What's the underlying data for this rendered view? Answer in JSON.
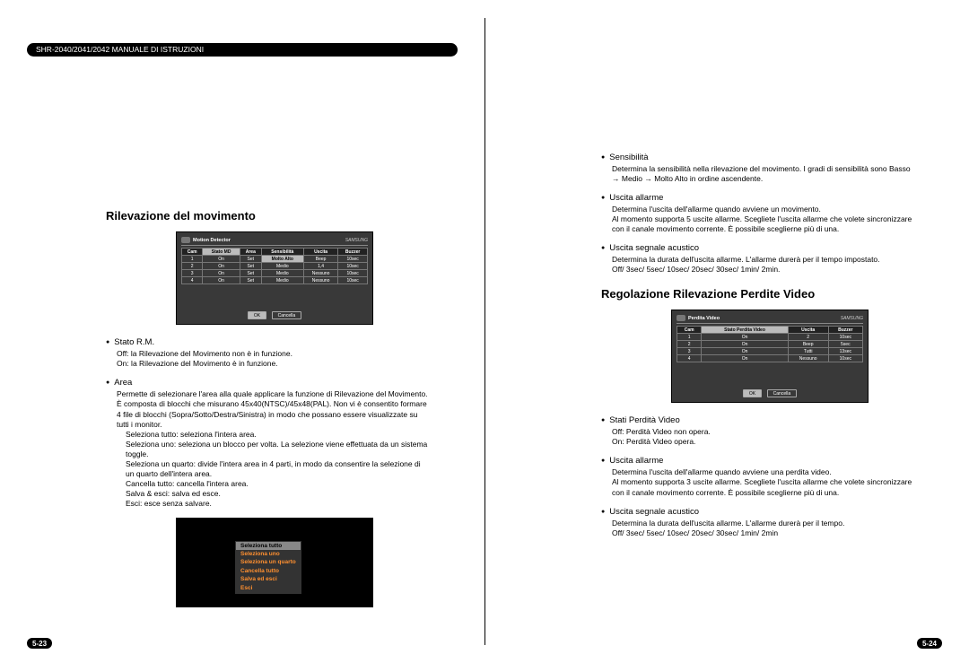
{
  "banner": "SHR-2040/2041/2042 MANUALE DI ISTRUZIONI",
  "page_left": "5-23",
  "page_right": "5-24",
  "section_left_title": "Rilevazione del movimento",
  "scr1": {
    "title": "Motion Detector",
    "logo": "SAMSUNG",
    "headers": [
      "Cam",
      "Stato MD",
      "Area",
      "Sensibilità",
      "Uscita",
      "Buzzer"
    ],
    "rows": [
      [
        "1",
        "On",
        "Set",
        "Molto Alto",
        "Beep",
        "10sec"
      ],
      [
        "2",
        "On",
        "Set",
        "Medio",
        "1,4",
        "10sec"
      ],
      [
        "3",
        "On",
        "Set",
        "Medio",
        "Nessuno",
        "10sec"
      ],
      [
        "4",
        "On",
        "Set",
        "Medio",
        "Nessuno",
        "10sec"
      ]
    ],
    "btn_ok": "OK",
    "btn_cancel": "Cancella"
  },
  "left_items": [
    {
      "label": "Stato R.M.",
      "desc": "Off: la Rilevazione del Movimento non è in funzione.\nOn: la Rilevazione del Movimento è in funzione."
    },
    {
      "label": "Area",
      "desc": "Permette di selezionare l'area alla quale applicare la funzione di Rilevazione del Movimento. È composta di blocchi che misurano 45x40(NTSC)/45x48(PAL). Non vi è consentito formare 4 file di blocchi (Sopra/Sotto/Destra/Sinistra) in modo che possano essere visualizzate su tutti i monitor.",
      "sublines": [
        "Seleziona tutto: seleziona l'intera area.",
        "Seleziona uno: seleziona un blocco per volta. La selezione viene effettuata da un sistema toggle.",
        "Seleziona un quarto: divide l'intera area in 4 parti, in modo da consentire la selezione di un quarto dell'intera area.",
        "Cancella tutto: cancella l'intera area.",
        "Salva & esci: salva ed esce.",
        "Esci: esce senza salvare."
      ]
    }
  ],
  "scr3_items": [
    "Seleziona tutto",
    "Seleziona uno",
    "Seleziona un quarto",
    "Cancella tutto",
    "Salva ed esci",
    "Esci"
  ],
  "right_items_top": [
    {
      "label": "Sensibilità",
      "desc": "Determina la sensibilità nella rilevazione del movimento. I gradi di sensibilità sono Basso → Medio → Molto Alto in ordine ascendente."
    },
    {
      "label": "Uscita allarme",
      "desc": "Determina l'uscita dell'allarme quando avviene un movimento.\nAl momento supporta 5 uscite allarme. Scegliete l'uscita allarme che volete sincronizzare con il canale movimento corrente. È possibile sceglierne più di una."
    },
    {
      "label": "Uscita segnale acustico",
      "desc": "Determina la durata dell'uscita allarme. L'allarme durerà per il tempo impostato.\nOff/ 3sec/ 5sec/ 10sec/ 20sec/ 30sec/ 1min/ 2min."
    }
  ],
  "section_right_title": "Regolazione Rilevazione Perdite Video",
  "scr2": {
    "title": "Perdita Video",
    "logo": "SAMSUNG",
    "headers": [
      "Cam",
      "Stato Perdita Video",
      "Uscita",
      "Buzzer"
    ],
    "rows": [
      [
        "1",
        "On",
        "2",
        "10sec"
      ],
      [
        "2",
        "On",
        "Beep",
        "5sec"
      ],
      [
        "3",
        "On",
        "Tutti",
        "13sec"
      ],
      [
        "4",
        "On",
        "Nessuno",
        "10sec"
      ]
    ],
    "btn_ok": "OK",
    "btn_cancel": "Cancella"
  },
  "right_items_bottom": [
    {
      "label": "Stati Perdità Video",
      "desc": "Off: Perdità Video non opera.\nOn: Perdità Video opera."
    },
    {
      "label": "Uscita allarme",
      "desc": "Determina l'uscita dell'allarme quando avviene una perdita video.\nAl momento supporta 3 uscite allarme. Scegliete l'uscita allarme che volete sincronizzare con il canale movimento corrente. È possibile sceglierne più di una."
    },
    {
      "label": "Uscita segnale acustico",
      "desc": "Determina la durata dell'uscita allarme. L'allarme durerà per il tempo.\nOff/ 3sec/ 5sec/ 10sec/ 20sec/ 30sec/ 1min/ 2min"
    }
  ]
}
